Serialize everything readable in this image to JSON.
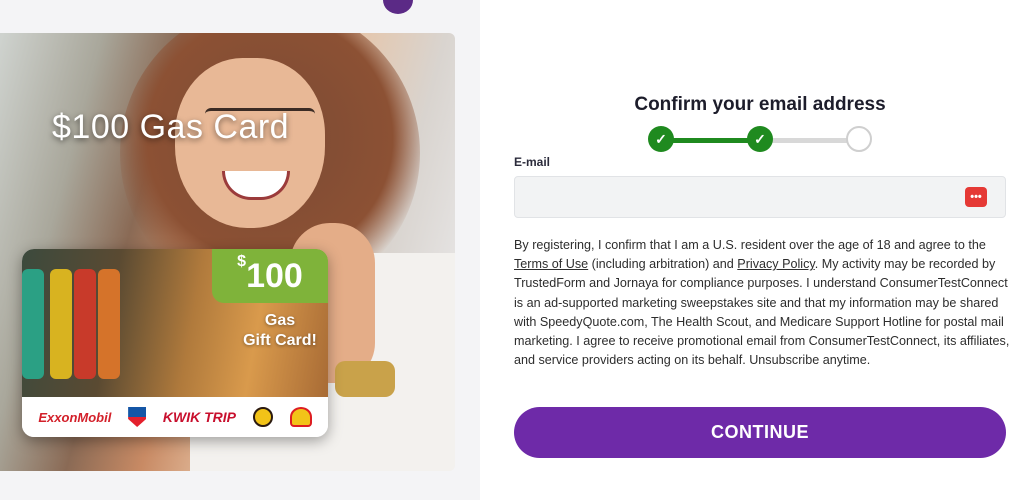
{
  "hero": {
    "title": "$100 Gas Card",
    "card": {
      "currency": "$",
      "amount": "100",
      "gift_line1": "Gas",
      "gift_line2": "Gift Card!",
      "brands": [
        "ExxonMobil",
        "Chevron",
        "KWIK TRIP",
        "Buc-ee's",
        "Shell"
      ]
    }
  },
  "form": {
    "title": "Confirm your email address",
    "progress": {
      "steps_total": 3,
      "steps_completed": 2,
      "check_glyph": "✓"
    },
    "email": {
      "label": "E-mail",
      "value": "",
      "placeholder": "",
      "icon": "password-manager-icon",
      "icon_glyph": "•••"
    },
    "consent": {
      "p1": "By registering, I confirm that I am a U.S. resident over the age of 18 and agree to the ",
      "terms_link": "Terms of Use",
      "p2": " (including arbitration) and ",
      "privacy_link": "Privacy Policy",
      "p3": ". My activity may be recorded by TrustedForm and Jornaya for compliance purposes. I understand ConsumerTestConnect is an ad-supported marketing sweepstakes site and that my information may be shared with SpeedyQuote.com, The Health Scout, and Medicare Support Hotline for postal mail marketing. I agree to receive promotional email from ConsumerTestConnect, its affiliates, and service providers acting on its behalf. Unsubscribe anytime."
    },
    "continue_label": "CONTINUE"
  },
  "colors": {
    "accent": "#6e2aa8",
    "progress_done": "#1f8a1f",
    "progress_todo": "#d8d8d8",
    "badge": "#7fb33a"
  }
}
